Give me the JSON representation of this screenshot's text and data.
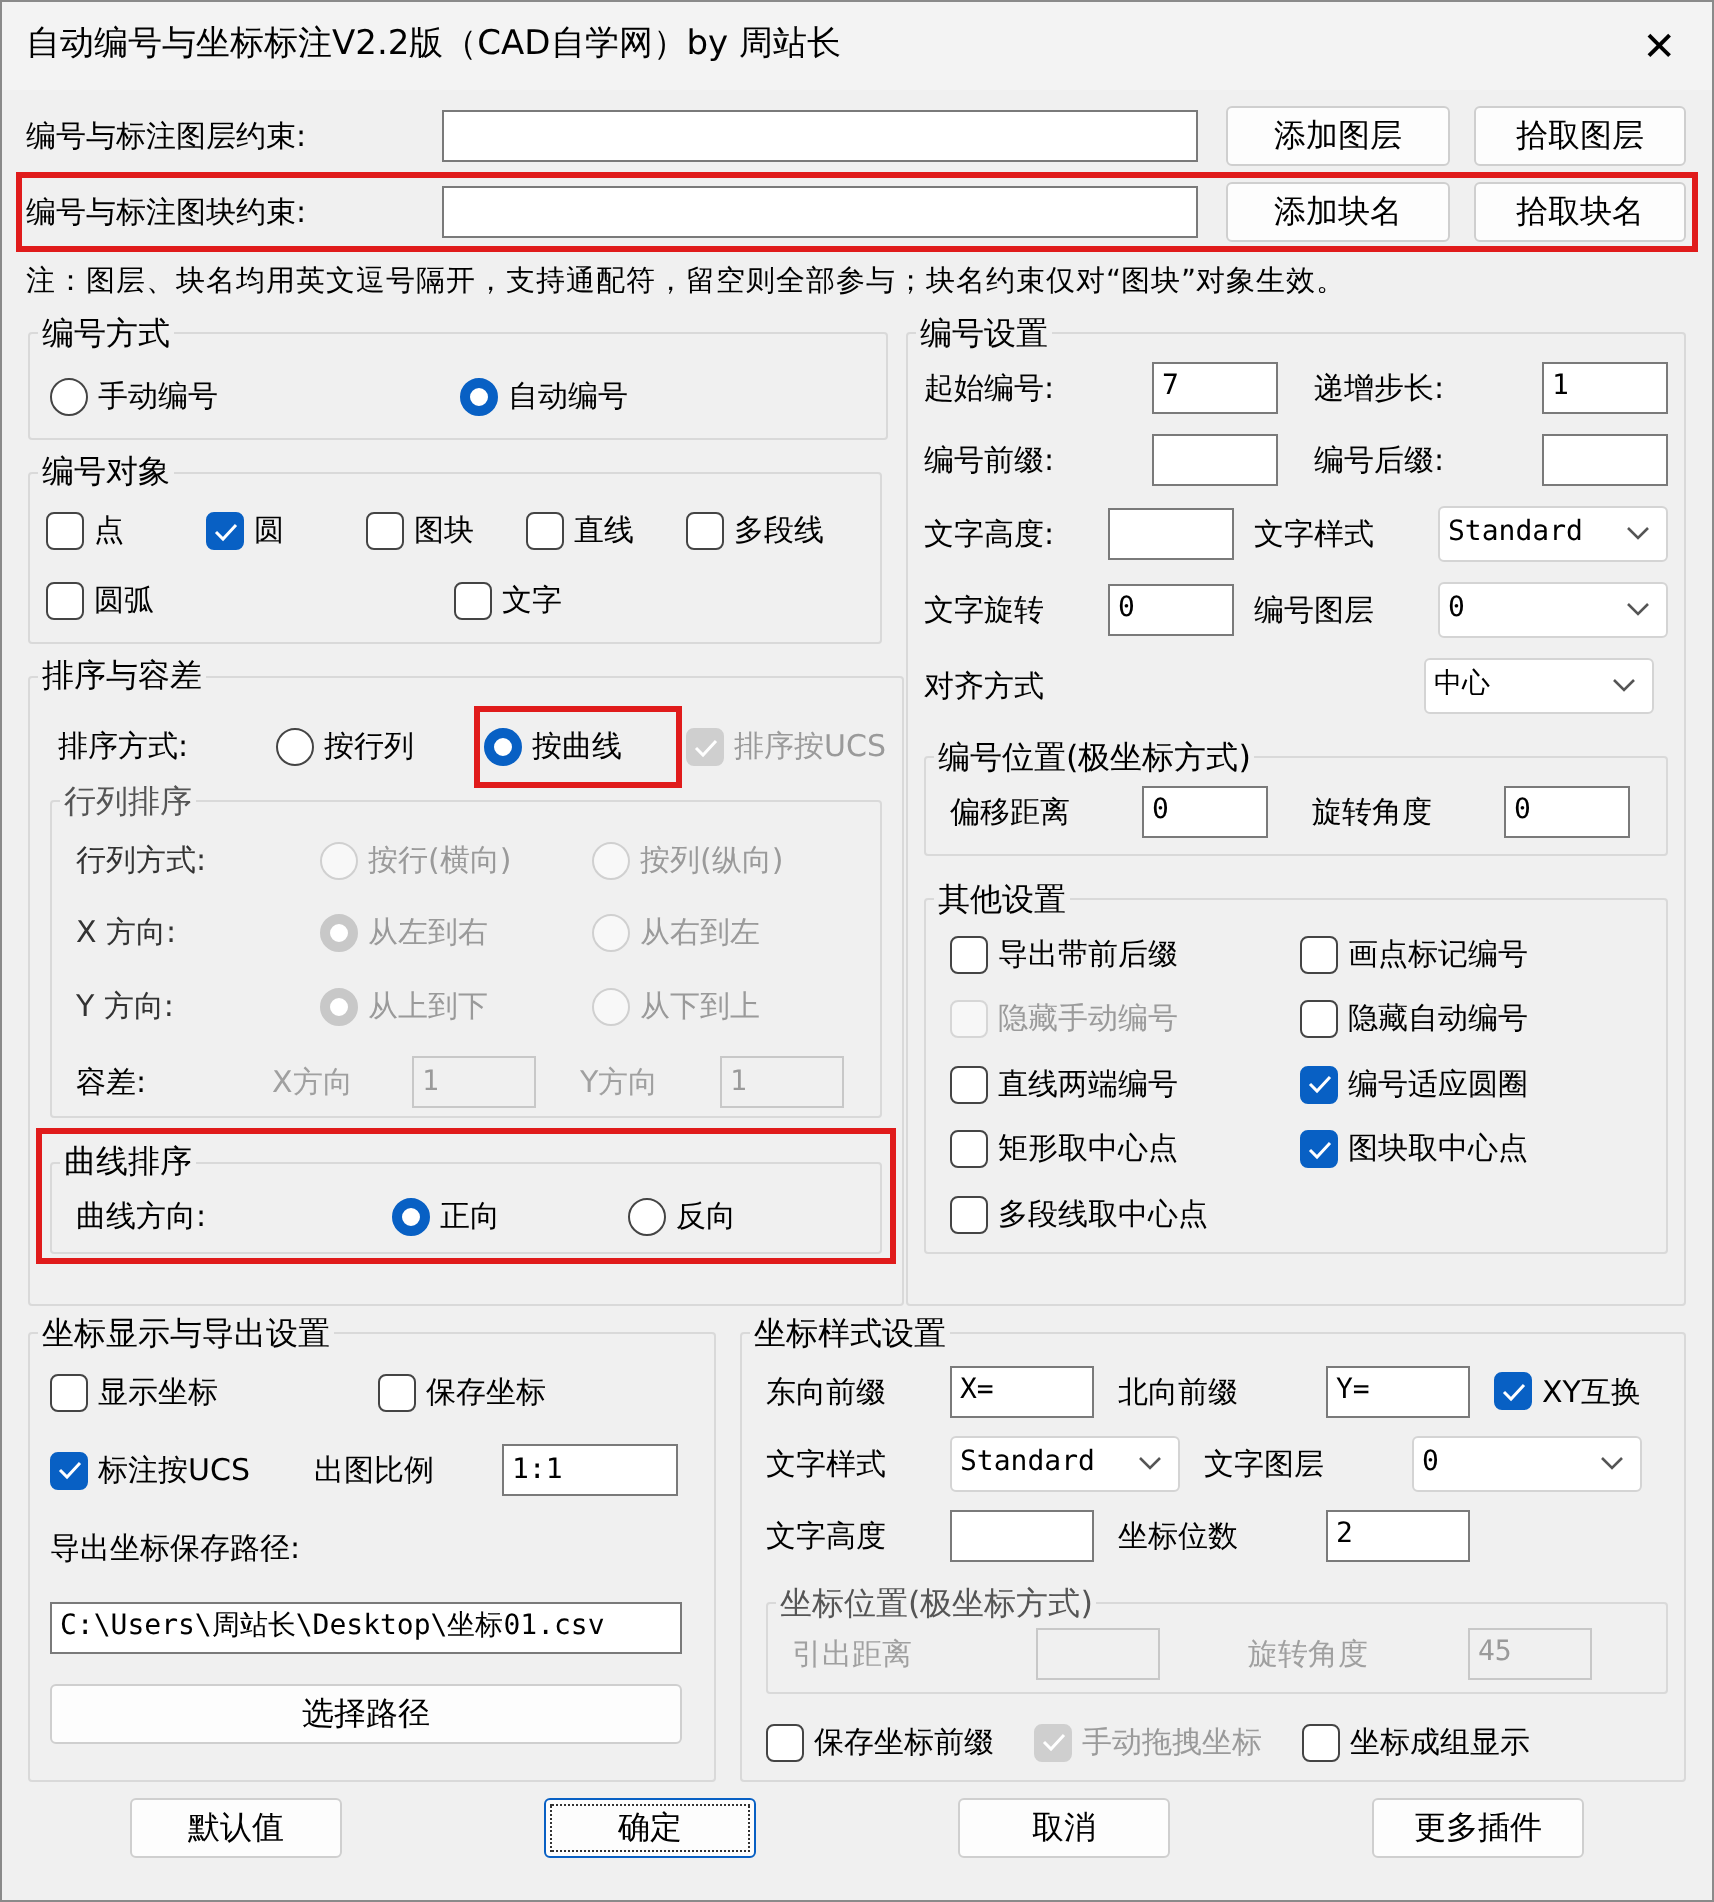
{
  "window": {
    "title": "自动编号与坐标标注V2.2版（CAD自学网）by 周站长",
    "close": "✕"
  },
  "constraints": [
    {
      "label": "编号与标注图层约束:",
      "buttons": [
        "添加图层",
        "拾取图层"
      ],
      "highlighted": false
    },
    {
      "label": "编号与标注图块约束:",
      "buttons": [
        "添加块名",
        "拾取块名"
      ],
      "highlighted": true
    }
  ],
  "note": "注：图层、块名均用英文逗号隔开，支持通配符，留空则全部参与；块名约束仅对“图块”对象生效。",
  "numbering_mode": {
    "title": "编号方式",
    "options": [
      {
        "label": "手动编号",
        "selected": false
      },
      {
        "label": "自动编号",
        "selected": true
      }
    ]
  },
  "numbering_objects": {
    "title": "编号对象",
    "rows": [
      [
        {
          "label": "点",
          "checked": false
        },
        {
          "label": "圆",
          "checked": true
        },
        {
          "label": "图块",
          "checked": false
        },
        {
          "label": "直线",
          "checked": false
        },
        {
          "label": "多段线",
          "checked": false
        }
      ],
      [
        {
          "label": "圆弧",
          "checked": false
        },
        {
          "label": "文字",
          "checked": false
        }
      ]
    ]
  },
  "sorting": {
    "title": "排序与容差",
    "label": "排序方式:",
    "options": [
      {
        "label": "按行列",
        "selected": false,
        "highlighted": false
      },
      {
        "label": "按曲线",
        "selected": true,
        "highlighted": true
      }
    ],
    "ucs": {
      "label": "排序按UCS",
      "checked": true,
      "disabled": true
    },
    "row_col": {
      "title": "行列排序",
      "disabled": true,
      "rows": [
        {
          "label": "行列方式:",
          "options": [
            {
              "label": "按行(横向)",
              "selected": false
            },
            {
              "label": "按列(纵向)",
              "selected": false
            }
          ]
        },
        {
          "label": "X 方向:",
          "options": [
            {
              "label": "从左到右",
              "selected": true
            },
            {
              "label": "从右到左",
              "selected": false
            }
          ]
        },
        {
          "label": "Y 方向:",
          "options": [
            {
              "label": "从上到下",
              "selected": true
            },
            {
              "label": "从下到上",
              "selected": false
            }
          ]
        }
      ],
      "tolerance": {
        "label": "容差:",
        "x_label": "X方向",
        "x_value": "1",
        "y_label": "Y方向",
        "y_value": "1"
      }
    },
    "curve": {
      "title": "曲线排序",
      "highlighted": true,
      "label": "曲线方向:",
      "options": [
        {
          "label": "正向",
          "selected": true
        },
        {
          "label": "反向",
          "selected": false
        }
      ]
    }
  },
  "numbering_settings": {
    "title": "编号设置",
    "rows": [
      [
        {
          "kind": "field",
          "label": "起始编号:",
          "value": "7"
        },
        {
          "kind": "field",
          "label": "递增步长:",
          "value": "1"
        }
      ],
      [
        {
          "kind": "field",
          "label": "编号前缀:"
        },
        {
          "kind": "field",
          "label": "编号后缀:"
        }
      ],
      [
        {
          "kind": "field",
          "label": "文字高度:"
        },
        {
          "kind": "select",
          "label": "文字样式",
          "value": "Standard"
        }
      ],
      [
        {
          "kind": "field",
          "label": "文字旋转",
          "value": "0"
        },
        {
          "kind": "select",
          "label": "编号图层",
          "value": "0"
        }
      ],
      [
        {
          "kind": "select",
          "label": "对齐方式",
          "value": "中心"
        }
      ]
    ],
    "position": {
      "title": "编号位置(极坐标方式)",
      "fields": [
        {
          "label": "偏移距离",
          "value": "0"
        },
        {
          "label": "旋转角度",
          "value": "0"
        }
      ]
    },
    "other": {
      "title": "其他设置",
      "items": [
        {
          "label": "导出带前后缀",
          "checked": false,
          "disabled": false
        },
        {
          "label": "画点标记编号",
          "checked": false,
          "disabled": false
        },
        {
          "label": "隐藏手动编号",
          "checked": false,
          "disabled": true
        },
        {
          "label": "隐藏自动编号",
          "checked": false,
          "disabled": false
        },
        {
          "label": "直线两端编号",
          "checked": false,
          "disabled": false
        },
        {
          "label": "编号适应圆圈",
          "checked": true,
          "disabled": false
        },
        {
          "label": "矩形取中心点",
          "checked": false,
          "disabled": false
        },
        {
          "label": "图块取中心点",
          "checked": true,
          "disabled": false
        },
        {
          "label": "多段线取中心点",
          "checked": false,
          "disabled": false
        }
      ]
    }
  },
  "coord_export": {
    "title": "坐标显示与导出设置",
    "checks": [
      {
        "label": "显示坐标",
        "checked": false
      },
      {
        "label": "保存坐标",
        "checked": false
      },
      {
        "label": "标注按UCS",
        "checked": true
      }
    ],
    "scale": {
      "label": "出图比例",
      "value": "1:1"
    },
    "path_label": "导出坐标保存路径:",
    "path": "C:\\Users\\周站长\\Desktop\\坐标01.csv",
    "button": "选择路径"
  },
  "coord_style": {
    "title": "坐标样式设置",
    "rows": [
      [
        {
          "kind": "field",
          "label": "东向前缀",
          "value": "X="
        },
        {
          "kind": "field",
          "label": "北向前缀",
          "value": "Y="
        },
        {
          "kind": "check",
          "label": "XY互换",
          "checked": true
        }
      ],
      [
        {
          "kind": "select",
          "label": "文字样式",
          "value": "Standard"
        },
        {
          "kind": "select",
          "label": "文字图层",
          "value": "0"
        }
      ],
      [
        {
          "kind": "field",
          "label": "文字高度"
        },
        {
          "kind": "field",
          "label": "坐标位数",
          "value": "2"
        }
      ]
    ],
    "position": {
      "title": "坐标位置(极坐标方式)",
      "disabled": true,
      "fields": [
        {
          "label": "引出距离"
        },
        {
          "label": "旋转角度",
          "value": "45"
        }
      ]
    },
    "checks": [
      {
        "label": "保存坐标前缀",
        "checked": false,
        "disabled": false
      },
      {
        "label": "手动拖拽坐标",
        "checked": true,
        "disabled": true
      },
      {
        "label": "坐标成组显示",
        "checked": false,
        "disabled": false
      }
    ]
  },
  "buttons": [
    {
      "label": "默认值",
      "focused": false
    },
    {
      "label": "确定",
      "focused": true
    },
    {
      "label": "取消",
      "focused": false
    },
    {
      "label": "更多插件",
      "focused": false
    }
  ]
}
